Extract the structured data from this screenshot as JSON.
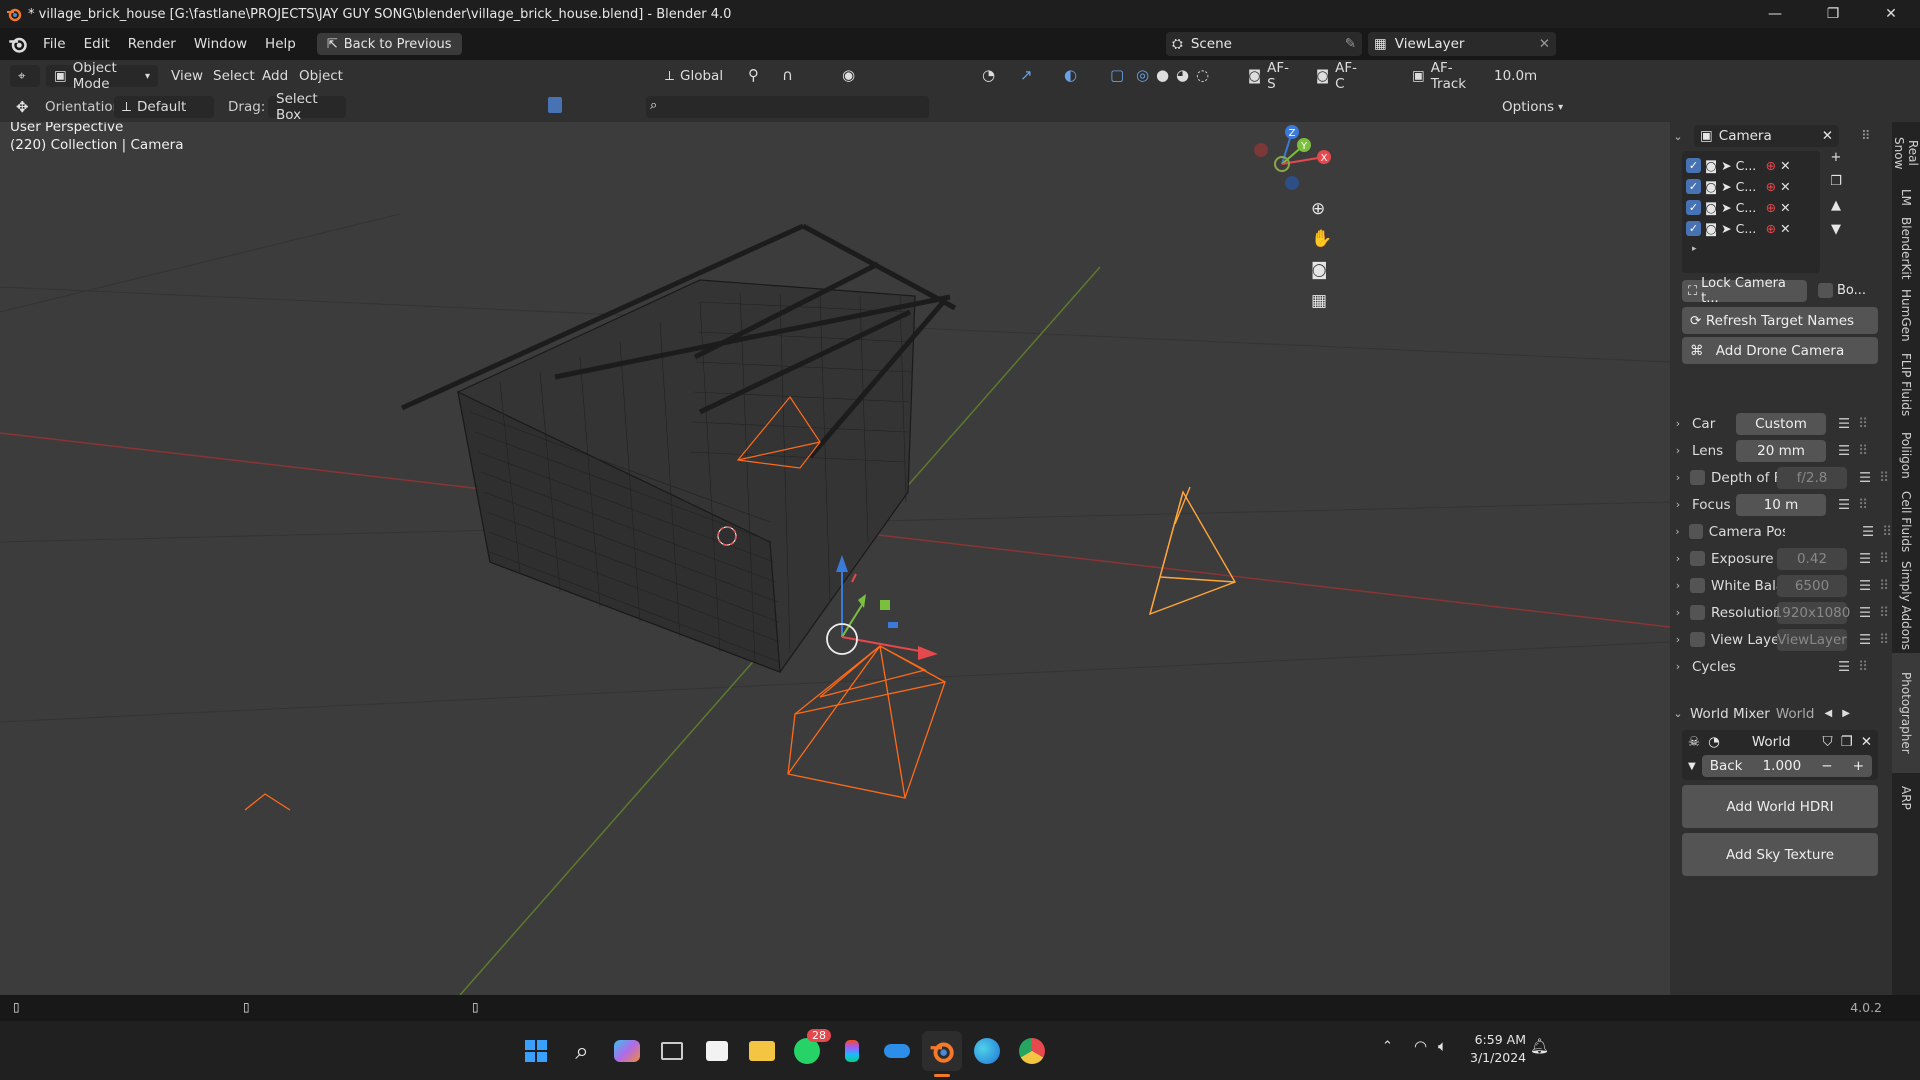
{
  "window": {
    "title": "* village_brick_house [G:\\fastlane\\PROJECTS\\JAY GUY SONG\\blender\\village_brick_house.blend] - Blender 4.0",
    "controls": [
      "—",
      "❐",
      "✕"
    ]
  },
  "menubar": {
    "items": [
      "File",
      "Edit",
      "Render",
      "Window",
      "Help"
    ],
    "back_button": "Back to Previous",
    "scene_label": "Scene",
    "view_layer_label": "ViewLayer"
  },
  "header": {
    "mode": "Object Mode",
    "menus": [
      "View",
      "Select",
      "Add",
      "Object"
    ],
    "transform": "Global",
    "af_s": "AF-S",
    "af_c": "AF-C",
    "af_track": "AF-Track",
    "distance": "10.0m"
  },
  "toolheader": {
    "orientation_label": "Orientation:",
    "orientation_value": "Default",
    "drag_label": "Drag:",
    "drag_value": "Select Box",
    "options": "Options"
  },
  "viewport": {
    "perspective": "User Perspective",
    "collection": "(220) Collection | Camera",
    "gizmo_axes": [
      "Z",
      "Y",
      "X"
    ]
  },
  "sidebar": {
    "camera_title": "Camera",
    "camera_list": [
      "C...",
      "C...",
      "C...",
      "C..."
    ],
    "lock_camera": "Lock Camera t...",
    "bo_label": "Bo...",
    "refresh": "Refresh Target Names",
    "add_drone": "Add Drone Camera",
    "rows": [
      {
        "label": "Car",
        "value": "Custom",
        "checkbox": false
      },
      {
        "label": "Lens",
        "value": "20 mm",
        "checkbox": false
      },
      {
        "label": "Depth of Field",
        "value": "f/2.8",
        "checkbox": true
      },
      {
        "label": "Focus",
        "value": "10 m",
        "checkbox": false
      },
      {
        "label": "Camera Post FX",
        "value": "",
        "checkbox": true
      },
      {
        "label": "Exposure",
        "value": "0.42",
        "checkbox": true
      },
      {
        "label": "White Balance",
        "value": "6500",
        "checkbox": true
      },
      {
        "label": "Resolution",
        "value": "1920x1080",
        "checkbox": true
      },
      {
        "label": "View Layers",
        "value": "ViewLayer",
        "checkbox": true
      },
      {
        "label": "Cycles",
        "value": "",
        "checkbox": false
      }
    ],
    "world_mixer": "World Mixer",
    "world_mixer_value": "World",
    "world_name": "World",
    "back_label": "Back",
    "back_value": "1.000",
    "add_world_hdri": "Add World HDRI",
    "add_sky_texture": "Add Sky Texture"
  },
  "tabs": [
    "Real Snow",
    "LM",
    "BlenderKit",
    "HumGen",
    "FLIP Fluids",
    "Poliigon",
    "Cell Fluids",
    "Simply Addons",
    "Photographer",
    "ARP"
  ],
  "statusbar": {
    "version": "4.0.2"
  },
  "taskbar": {
    "whatsapp_badge": "28",
    "time": "6:59 AM",
    "date": "3/1/2024"
  },
  "colors": {
    "accent": "#4772b3",
    "camera_orange": "#ff6a1a",
    "x_axis": "#e5484d",
    "y_axis": "#7bbf3f",
    "z_axis": "#3b7ad8"
  }
}
